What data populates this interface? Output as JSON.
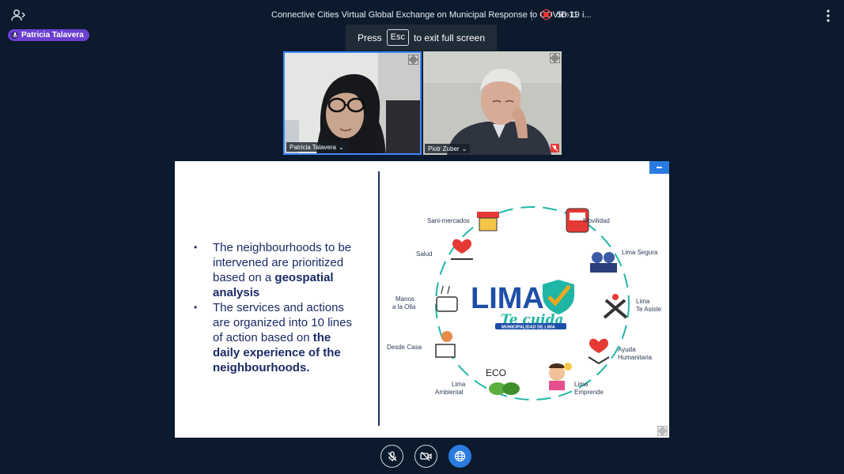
{
  "meeting": {
    "title": "Connective Cities Virtual Global Exchange on Municipal Response to COVID-19 i...",
    "elapsed": "56:11"
  },
  "active_speaker": "Patricia Talavera",
  "fullscreen_toast": {
    "press": "Press",
    "key": "Esc",
    "suffix": "to exit full screen"
  },
  "participants": [
    {
      "name": "Patricia Talavera",
      "muted": false,
      "speaking": true
    },
    {
      "name": "Piotr Zuber",
      "muted": true,
      "speaking": false
    }
  ],
  "slide": {
    "bullet1": {
      "text": "The neighbourhoods to be intervened are prioritized based on a",
      "bold": "geospatial analysis"
    },
    "bullet2": {
      "text": "The services and actions are organized into 10 lines of action based on",
      "bold": "the daily experience of the neighbourhoods."
    },
    "logo": {
      "main": "LIMA",
      "script": "Te cuida",
      "sub": "MUNICIPALIDAD DE LIMA"
    },
    "nodes": {
      "sani_mercados": "Sani-mercados",
      "movilidad": "Movilidad",
      "lima_segura": "Lima Segura",
      "salud": "Salud",
      "lima_te_asiste_1": "Lima",
      "lima_te_asiste_2": "Te Asiste",
      "manos_1": "Manos",
      "manos_2": "a la Olla",
      "desde_casa": "Desde Casa",
      "ayuda_1": "Ayuda",
      "ayuda_2": "Humanitaria",
      "eco": "ECO",
      "ambiental_1": "Lima",
      "ambiental_2": "Ambiental",
      "emprende_1": "Lima",
      "emprende_2": "Emprende"
    }
  },
  "colors": {
    "background": "#0b1a2c",
    "accent": "#2a7be0",
    "speaker_badge": "#6b3fd0",
    "slide_text": "#1b2a66",
    "logo_blue": "#1e4fa8",
    "logo_teal": "#1fb6a6",
    "record": "#ff3030"
  }
}
